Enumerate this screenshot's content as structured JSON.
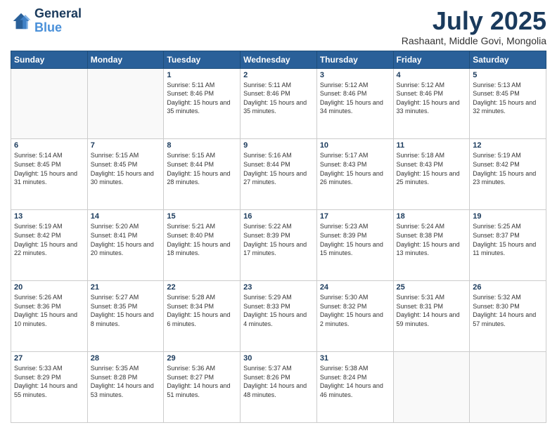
{
  "logo": {
    "line1": "General",
    "line2": "Blue"
  },
  "title": "July 2025",
  "subtitle": "Rashaant, Middle Govi, Mongolia",
  "header_days": [
    "Sunday",
    "Monday",
    "Tuesday",
    "Wednesday",
    "Thursday",
    "Friday",
    "Saturday"
  ],
  "weeks": [
    [
      {
        "day": "",
        "sunrise": "",
        "sunset": "",
        "daylight": ""
      },
      {
        "day": "",
        "sunrise": "",
        "sunset": "",
        "daylight": ""
      },
      {
        "day": "1",
        "sunrise": "Sunrise: 5:11 AM",
        "sunset": "Sunset: 8:46 PM",
        "daylight": "Daylight: 15 hours and 35 minutes."
      },
      {
        "day": "2",
        "sunrise": "Sunrise: 5:11 AM",
        "sunset": "Sunset: 8:46 PM",
        "daylight": "Daylight: 15 hours and 35 minutes."
      },
      {
        "day": "3",
        "sunrise": "Sunrise: 5:12 AM",
        "sunset": "Sunset: 8:46 PM",
        "daylight": "Daylight: 15 hours and 34 minutes."
      },
      {
        "day": "4",
        "sunrise": "Sunrise: 5:12 AM",
        "sunset": "Sunset: 8:46 PM",
        "daylight": "Daylight: 15 hours and 33 minutes."
      },
      {
        "day": "5",
        "sunrise": "Sunrise: 5:13 AM",
        "sunset": "Sunset: 8:45 PM",
        "daylight": "Daylight: 15 hours and 32 minutes."
      }
    ],
    [
      {
        "day": "6",
        "sunrise": "Sunrise: 5:14 AM",
        "sunset": "Sunset: 8:45 PM",
        "daylight": "Daylight: 15 hours and 31 minutes."
      },
      {
        "day": "7",
        "sunrise": "Sunrise: 5:15 AM",
        "sunset": "Sunset: 8:45 PM",
        "daylight": "Daylight: 15 hours and 30 minutes."
      },
      {
        "day": "8",
        "sunrise": "Sunrise: 5:15 AM",
        "sunset": "Sunset: 8:44 PM",
        "daylight": "Daylight: 15 hours and 28 minutes."
      },
      {
        "day": "9",
        "sunrise": "Sunrise: 5:16 AM",
        "sunset": "Sunset: 8:44 PM",
        "daylight": "Daylight: 15 hours and 27 minutes."
      },
      {
        "day": "10",
        "sunrise": "Sunrise: 5:17 AM",
        "sunset": "Sunset: 8:43 PM",
        "daylight": "Daylight: 15 hours and 26 minutes."
      },
      {
        "day": "11",
        "sunrise": "Sunrise: 5:18 AM",
        "sunset": "Sunset: 8:43 PM",
        "daylight": "Daylight: 15 hours and 25 minutes."
      },
      {
        "day": "12",
        "sunrise": "Sunrise: 5:19 AM",
        "sunset": "Sunset: 8:42 PM",
        "daylight": "Daylight: 15 hours and 23 minutes."
      }
    ],
    [
      {
        "day": "13",
        "sunrise": "Sunrise: 5:19 AM",
        "sunset": "Sunset: 8:42 PM",
        "daylight": "Daylight: 15 hours and 22 minutes."
      },
      {
        "day": "14",
        "sunrise": "Sunrise: 5:20 AM",
        "sunset": "Sunset: 8:41 PM",
        "daylight": "Daylight: 15 hours and 20 minutes."
      },
      {
        "day": "15",
        "sunrise": "Sunrise: 5:21 AM",
        "sunset": "Sunset: 8:40 PM",
        "daylight": "Daylight: 15 hours and 18 minutes."
      },
      {
        "day": "16",
        "sunrise": "Sunrise: 5:22 AM",
        "sunset": "Sunset: 8:39 PM",
        "daylight": "Daylight: 15 hours and 17 minutes."
      },
      {
        "day": "17",
        "sunrise": "Sunrise: 5:23 AM",
        "sunset": "Sunset: 8:39 PM",
        "daylight": "Daylight: 15 hours and 15 minutes."
      },
      {
        "day": "18",
        "sunrise": "Sunrise: 5:24 AM",
        "sunset": "Sunset: 8:38 PM",
        "daylight": "Daylight: 15 hours and 13 minutes."
      },
      {
        "day": "19",
        "sunrise": "Sunrise: 5:25 AM",
        "sunset": "Sunset: 8:37 PM",
        "daylight": "Daylight: 15 hours and 11 minutes."
      }
    ],
    [
      {
        "day": "20",
        "sunrise": "Sunrise: 5:26 AM",
        "sunset": "Sunset: 8:36 PM",
        "daylight": "Daylight: 15 hours and 10 minutes."
      },
      {
        "day": "21",
        "sunrise": "Sunrise: 5:27 AM",
        "sunset": "Sunset: 8:35 PM",
        "daylight": "Daylight: 15 hours and 8 minutes."
      },
      {
        "day": "22",
        "sunrise": "Sunrise: 5:28 AM",
        "sunset": "Sunset: 8:34 PM",
        "daylight": "Daylight: 15 hours and 6 minutes."
      },
      {
        "day": "23",
        "sunrise": "Sunrise: 5:29 AM",
        "sunset": "Sunset: 8:33 PM",
        "daylight": "Daylight: 15 hours and 4 minutes."
      },
      {
        "day": "24",
        "sunrise": "Sunrise: 5:30 AM",
        "sunset": "Sunset: 8:32 PM",
        "daylight": "Daylight: 15 hours and 2 minutes."
      },
      {
        "day": "25",
        "sunrise": "Sunrise: 5:31 AM",
        "sunset": "Sunset: 8:31 PM",
        "daylight": "Daylight: 14 hours and 59 minutes."
      },
      {
        "day": "26",
        "sunrise": "Sunrise: 5:32 AM",
        "sunset": "Sunset: 8:30 PM",
        "daylight": "Daylight: 14 hours and 57 minutes."
      }
    ],
    [
      {
        "day": "27",
        "sunrise": "Sunrise: 5:33 AM",
        "sunset": "Sunset: 8:29 PM",
        "daylight": "Daylight: 14 hours and 55 minutes."
      },
      {
        "day": "28",
        "sunrise": "Sunrise: 5:35 AM",
        "sunset": "Sunset: 8:28 PM",
        "daylight": "Daylight: 14 hours and 53 minutes."
      },
      {
        "day": "29",
        "sunrise": "Sunrise: 5:36 AM",
        "sunset": "Sunset: 8:27 PM",
        "daylight": "Daylight: 14 hours and 51 minutes."
      },
      {
        "day": "30",
        "sunrise": "Sunrise: 5:37 AM",
        "sunset": "Sunset: 8:26 PM",
        "daylight": "Daylight: 14 hours and 48 minutes."
      },
      {
        "day": "31",
        "sunrise": "Sunrise: 5:38 AM",
        "sunset": "Sunset: 8:24 PM",
        "daylight": "Daylight: 14 hours and 46 minutes."
      },
      {
        "day": "",
        "sunrise": "",
        "sunset": "",
        "daylight": ""
      },
      {
        "day": "",
        "sunrise": "",
        "sunset": "",
        "daylight": ""
      }
    ]
  ]
}
